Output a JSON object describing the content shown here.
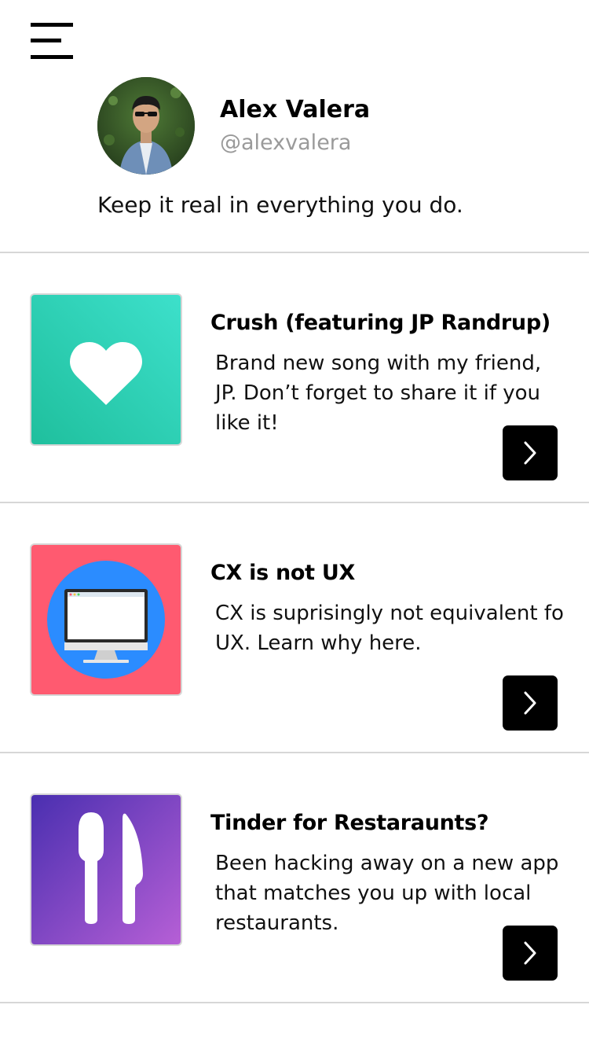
{
  "header": {
    "menu_icon": "hamburger-menu-icon"
  },
  "profile": {
    "name": "Alex Valera",
    "handle": "@alexvalera",
    "bio": "Keep it real in everything you do."
  },
  "feed": [
    {
      "title": "Crush (featuring JP Randrup)",
      "description": "Brand new song with my friend, JP. Don’t forget to share it if you like it!",
      "icon": "heart-icon",
      "colors": [
        "#1fbf9d",
        "#3de0cb"
      ]
    },
    {
      "title": "CX is not UX",
      "description": "CX is suprisingly not equivalent fo UX. Learn why here.",
      "icon": "monitor-icon",
      "colors": [
        "#ff5a70",
        "#2b8cff"
      ]
    },
    {
      "title": "Tinder for Restaraunts?",
      "description": "Been hacking away on a new app that matches you up with local restaurants.",
      "icon": "utensils-icon",
      "colors": [
        "#4a2fb0",
        "#b65fd6"
      ]
    }
  ],
  "colors": {
    "divider": "#d7d7d7",
    "handle": "#9a9a9a",
    "button": "#000000"
  }
}
